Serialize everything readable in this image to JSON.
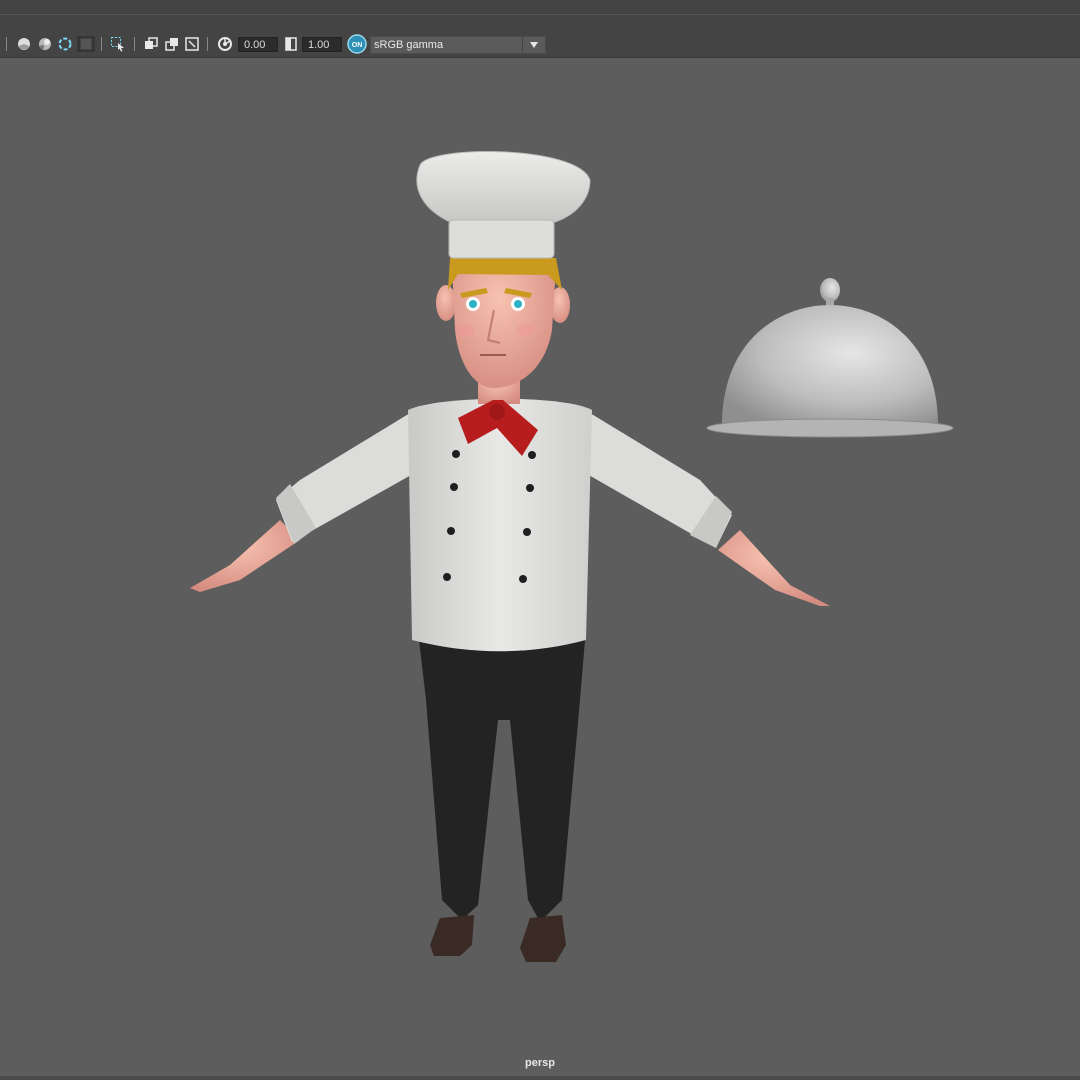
{
  "toolbar": {
    "exposure_value": "0.00",
    "gamma_value": "1.00",
    "color_management_badge": "ON",
    "view_transform": "sRGB gamma",
    "icons": [
      "shaded-sphere-icon",
      "textured-sphere-icon",
      "ambient-occlusion-icon",
      "isolate-select-icon",
      "xray-icon",
      "xray-joints-icon",
      "xray-active-icon",
      "resolution-gate-icon",
      "exposure-icon",
      "gamma-icon",
      "color-management-icon"
    ]
  },
  "viewport": {
    "camera_label": "persp",
    "background": "#5d5d5d",
    "objects": [
      "chef-character",
      "serving-cloche"
    ]
  }
}
